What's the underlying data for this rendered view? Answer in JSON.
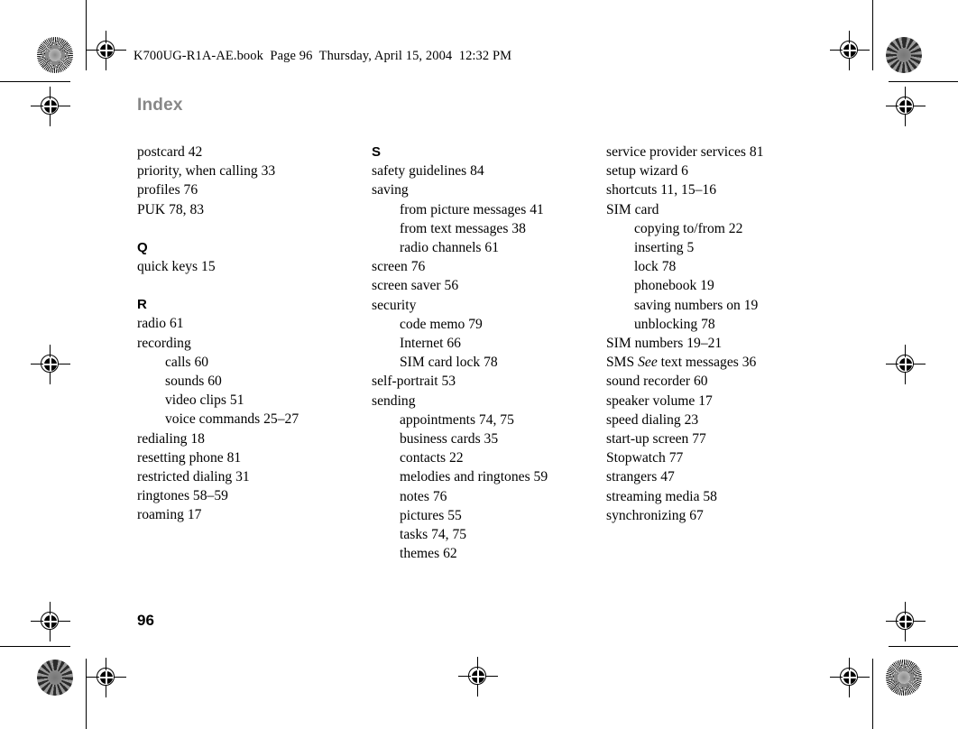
{
  "header": {
    "file_slug": "K700UG-R1A-AE.book  Page 96  Thursday, April 15, 2004  12:32 PM"
  },
  "page": {
    "title": "Index",
    "folio": "96"
  },
  "colors": {
    "title_gray": "#878787",
    "body_black": "#000000",
    "page_background": "#ffffff"
  },
  "columns": [
    {
      "id": "column-1",
      "blocks": [
        {
          "letter": null,
          "entries": [
            {
              "text": "postcard 42",
              "level": 0
            },
            {
              "text": "priority, when calling 33",
              "level": 0
            },
            {
              "text": "profiles 76",
              "level": 0
            },
            {
              "text": "PUK 78, 83",
              "level": 0
            }
          ]
        },
        {
          "letter": "Q",
          "entries": [
            {
              "text": "quick keys 15",
              "level": 0
            }
          ]
        },
        {
          "letter": "R",
          "entries": [
            {
              "text": "radio 61",
              "level": 0
            },
            {
              "text": "recording",
              "level": 0
            },
            {
              "text": "calls 60",
              "level": 1
            },
            {
              "text": "sounds 60",
              "level": 1
            },
            {
              "text": "video clips 51",
              "level": 1
            },
            {
              "text": "voice commands 25–27",
              "level": 1
            },
            {
              "text": "redialing 18",
              "level": 0
            },
            {
              "text": "resetting phone 81",
              "level": 0
            },
            {
              "text": "restricted dialing 31",
              "level": 0
            },
            {
              "text": "ringtones 58–59",
              "level": 0
            },
            {
              "text": "roaming 17",
              "level": 0
            }
          ]
        }
      ]
    },
    {
      "id": "column-2",
      "blocks": [
        {
          "letter": "S",
          "entries": [
            {
              "text": "safety guidelines 84",
              "level": 0
            },
            {
              "text": "saving",
              "level": 0
            },
            {
              "text": "from picture messages 41",
              "level": 1
            },
            {
              "text": "from text messages 38",
              "level": 1
            },
            {
              "text": "radio channels 61",
              "level": 1
            },
            {
              "text": "screen 76",
              "level": 0
            },
            {
              "text": "screen saver 56",
              "level": 0
            },
            {
              "text": "security",
              "level": 0
            },
            {
              "text": "code memo 79",
              "level": 1
            },
            {
              "text": "Internet 66",
              "level": 1
            },
            {
              "text": "SIM card lock 78",
              "level": 1
            },
            {
              "text": "self-portrait 53",
              "level": 0
            },
            {
              "text": "sending",
              "level": 0
            },
            {
              "text": "appointments 74, 75",
              "level": 1
            },
            {
              "text": "business cards 35",
              "level": 1
            },
            {
              "text": "contacts 22",
              "level": 1
            },
            {
              "text": "melodies and ringtones 59",
              "level": 1
            },
            {
              "text": "notes 76",
              "level": 1
            },
            {
              "text": "pictures 55",
              "level": 1
            },
            {
              "text": "tasks 74, 75",
              "level": 1
            },
            {
              "text": "themes 62",
              "level": 1
            }
          ]
        }
      ]
    },
    {
      "id": "column-3",
      "blocks": [
        {
          "letter": null,
          "entries": [
            {
              "text": "service provider services 81",
              "level": 0
            },
            {
              "text": "setup wizard 6",
              "level": 0
            },
            {
              "text": "shortcuts 11, 15–16",
              "level": 0
            },
            {
              "text": "SIM card",
              "level": 0
            },
            {
              "text": "copying to/from 22",
              "level": 1
            },
            {
              "text": "inserting 5",
              "level": 1
            },
            {
              "text": "lock 78",
              "level": 1
            },
            {
              "text": "phonebook 19",
              "level": 1
            },
            {
              "text": "saving numbers on 19",
              "level": 1
            },
            {
              "text": "unblocking 78",
              "level": 1
            },
            {
              "text": "SIM numbers 19–21",
              "level": 0
            },
            {
              "text": "SMS ",
              "italic": "See",
              "text_after": " text messages 36",
              "level": 0
            },
            {
              "text": "sound recorder 60",
              "level": 0
            },
            {
              "text": "speaker volume 17",
              "level": 0
            },
            {
              "text": "speed dialing 23",
              "level": 0
            },
            {
              "text": "start-up screen 77",
              "level": 0
            },
            {
              "text": "Stopwatch 77",
              "level": 0
            },
            {
              "text": "strangers 47",
              "level": 0
            },
            {
              "text": "streaming media 58",
              "level": 0
            },
            {
              "text": "synchronizing 67",
              "level": 0
            }
          ]
        }
      ]
    }
  ],
  "print_marks": {
    "registration_mark_label": "registration-crosshair",
    "star_target_label": "density-star-target",
    "trim_line_label": "trim-line"
  }
}
